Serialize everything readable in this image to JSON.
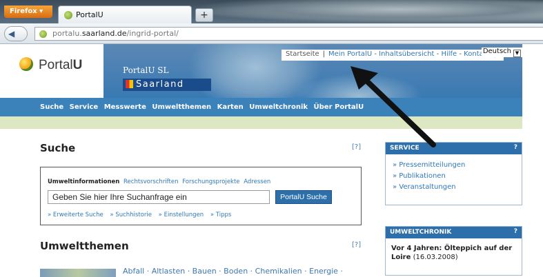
{
  "browser": {
    "app_button": "Firefox ▾",
    "tab_title": "PortalU",
    "new_tab": "+",
    "url_prefix": "portalu.",
    "url_domain": "saarland.de",
    "url_path": "/ingrid-portal/",
    "back": "◀",
    "forward": "▶"
  },
  "header": {
    "logo_text": "Portal",
    "logo_bold": "U",
    "subtitle": "PortalU SL",
    "state": "Saarland",
    "top_links": [
      "Startseite",
      "Mein PortalU",
      "Inhaltsübersicht",
      "Hilfe",
      "Kontakt"
    ],
    "language": "Deutsch"
  },
  "main_nav": [
    "Suche",
    "Service",
    "Messwerte",
    "Umweltthemen",
    "Karten",
    "Umweltchronik",
    "Über PortalU"
  ],
  "search": {
    "title": "Suche",
    "help": "[?]",
    "tabs": [
      "Umweltinformationen",
      "Rechtsvorschriften",
      "Forschungsprojekte",
      "Adressen"
    ],
    "input_value": "Geben Sie hier Ihre Suchanfrage ein",
    "button": "PortalU Suche",
    "links": [
      "» Erweiterte Suche",
      "» Suchhistorie",
      "» Einstellungen",
      "» Tipps"
    ]
  },
  "themes": {
    "title": "Umweltthemen",
    "help": "[?]",
    "items": "Abfall · Altlasten · Bauen · Boden · Chemikalien · Energie ·"
  },
  "service_box": {
    "title": "SERVICE",
    "help": "?",
    "items": [
      "» Pressemitteilungen",
      "» Publikationen",
      "» Veranstaltungen"
    ]
  },
  "chronik_box": {
    "title": "UMWELTCHRONIK",
    "help": "?",
    "headline": "Vor 4 Jahren: Ölteppich auf der Loire",
    "date": "(16.03.2008)"
  },
  "colors": {
    "nav_blue": "#3b82bb",
    "box_blue": "#2c6fab",
    "link_blue": "#2f78b7",
    "green_bar": "#dde8c3"
  }
}
